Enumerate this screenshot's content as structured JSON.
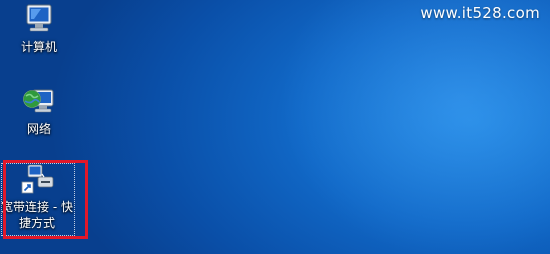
{
  "watermark": "www.it528.com",
  "desktop_icons": [
    {
      "label": "计算机",
      "icon": "computer-icon"
    },
    {
      "label": "网络",
      "icon": "network-icon"
    },
    {
      "label": "宽带连接 - 快捷方式",
      "icon": "broadband-shortcut-icon"
    }
  ],
  "colors": {
    "desktop_blue": "#1169c8",
    "highlight_red": "#e1182a"
  }
}
